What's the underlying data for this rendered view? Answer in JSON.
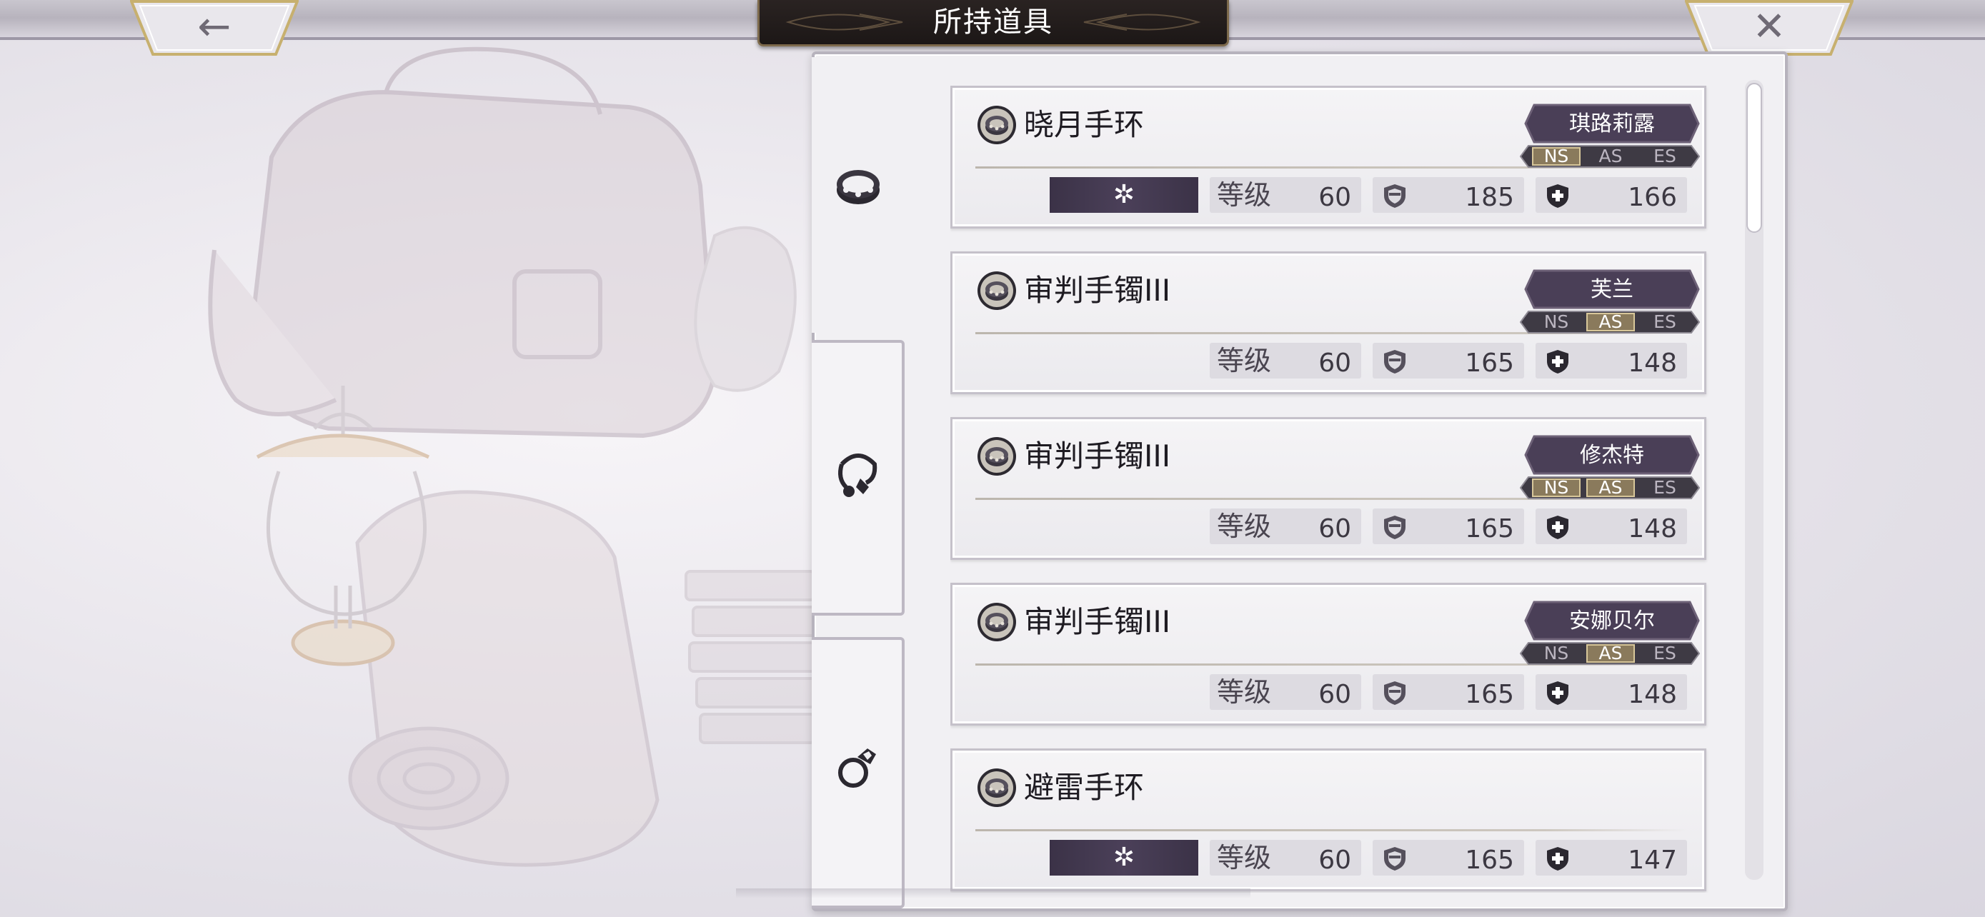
{
  "header": {
    "title": "所持道具",
    "back_icon": "arrow-left-icon",
    "close_icon": "close-x-icon",
    "back_glyph": "←",
    "close_glyph": "✕"
  },
  "tabs": [
    {
      "id": "bracelet",
      "icon": "bracelet-icon",
      "active": true
    },
    {
      "id": "necklace",
      "icon": "necklace-icon",
      "active": false
    },
    {
      "id": "ring",
      "icon": "ring-icon",
      "active": false
    }
  ],
  "stat_labels": {
    "level": "等级"
  },
  "items": [
    {
      "name": "晓月手环",
      "special": true,
      "special_glyph": "✲",
      "character": "琪路莉露",
      "classes": [
        "NS",
        "AS",
        "ES"
      ],
      "active_class": "NS",
      "level": "60",
      "defense": "185",
      "resist": "166"
    },
    {
      "name": "审判手镯III",
      "special": false,
      "character": "芙兰",
      "classes": [
        "NS",
        "AS",
        "ES"
      ],
      "active_class": "AS",
      "level": "60",
      "defense": "165",
      "resist": "148"
    },
    {
      "name": "审判手镯III",
      "special": false,
      "character": "修杰特",
      "classes": [
        "NS",
        "AS",
        "ES"
      ],
      "active_class": "NS,AS",
      "level": "60",
      "defense": "165",
      "resist": "148"
    },
    {
      "name": "审判手镯III",
      "special": false,
      "character": "安娜贝尔",
      "classes": [
        "NS",
        "AS",
        "ES"
      ],
      "active_class": "AS",
      "level": "60",
      "defense": "165",
      "resist": "148"
    },
    {
      "name": "避雷手环",
      "special": true,
      "special_glyph": "✲",
      "character": "",
      "classes": [],
      "active_class": "",
      "level": "60",
      "defense": "165",
      "resist": "147"
    }
  ],
  "colors": {
    "title_plate": "#1c1716",
    "character_tag": "#4a3f57",
    "special_badge": "#3b3247",
    "panel": "#f1f0f3"
  }
}
